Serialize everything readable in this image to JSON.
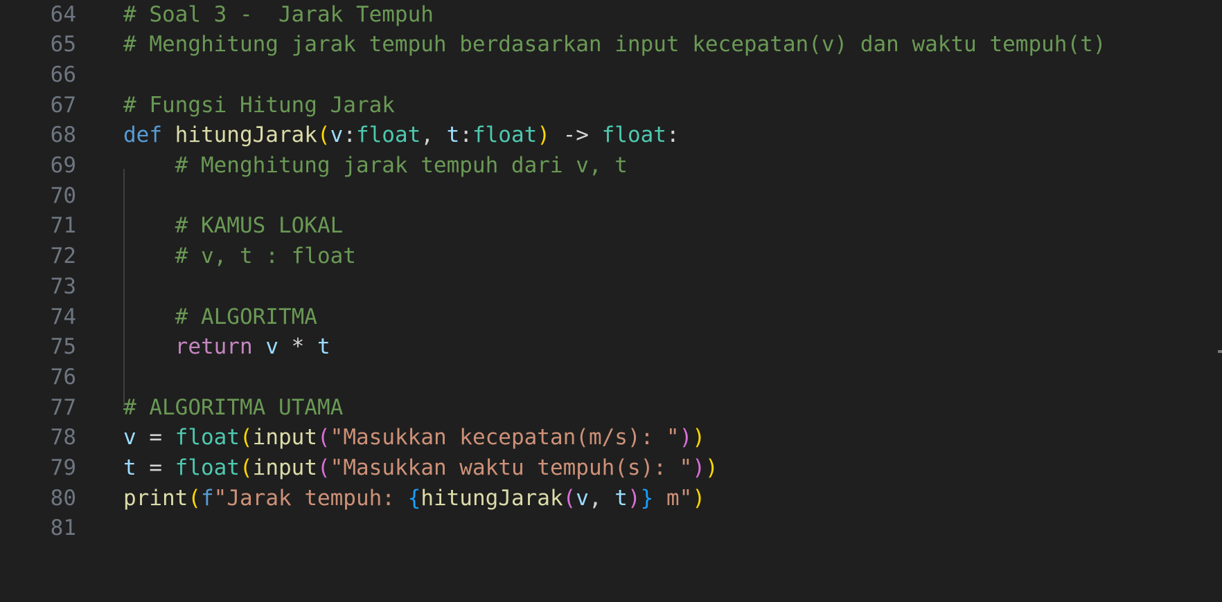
{
  "editor": {
    "lines": [
      {
        "n": "64",
        "tokens": [
          {
            "t": "# Soal 3 -  Jarak Tempuh",
            "c": "c"
          }
        ]
      },
      {
        "n": "65",
        "tokens": [
          {
            "t": "# Menghitung jarak tempuh berdasarkan input kecepatan(v) dan waktu tempuh(t)",
            "c": "c"
          }
        ]
      },
      {
        "n": "66",
        "tokens": []
      },
      {
        "n": "67",
        "tokens": [
          {
            "t": "# Fungsi Hitung Jarak",
            "c": "c"
          }
        ]
      },
      {
        "n": "68",
        "tokens": [
          {
            "t": "def ",
            "c": "k"
          },
          {
            "t": "hitungJarak",
            "c": "fn"
          },
          {
            "t": "(",
            "c": "b1"
          },
          {
            "t": "v",
            "c": "v"
          },
          {
            "t": ":",
            "c": "p"
          },
          {
            "t": "float",
            "c": "ty"
          },
          {
            "t": ", ",
            "c": "p"
          },
          {
            "t": "t",
            "c": "v"
          },
          {
            "t": ":",
            "c": "p"
          },
          {
            "t": "float",
            "c": "ty"
          },
          {
            "t": ")",
            "c": "b1"
          },
          {
            "t": " -> ",
            "c": "p"
          },
          {
            "t": "float",
            "c": "ty"
          },
          {
            "t": ":",
            "c": "p"
          }
        ]
      },
      {
        "n": "69",
        "tokens": [
          {
            "t": "    # Menghitung jarak tempuh dari v, t",
            "c": "c"
          }
        ]
      },
      {
        "n": "70",
        "tokens": []
      },
      {
        "n": "71",
        "tokens": [
          {
            "t": "    # KAMUS LOKAL",
            "c": "c"
          }
        ]
      },
      {
        "n": "72",
        "tokens": [
          {
            "t": "    # v, t : float",
            "c": "c"
          }
        ]
      },
      {
        "n": "73",
        "tokens": []
      },
      {
        "n": "74",
        "tokens": [
          {
            "t": "    # ALGORITMA",
            "c": "c"
          }
        ]
      },
      {
        "n": "75",
        "tokens": [
          {
            "t": "    ",
            "c": "p"
          },
          {
            "t": "return",
            "c": "kw"
          },
          {
            "t": " ",
            "c": "p"
          },
          {
            "t": "v",
            "c": "v"
          },
          {
            "t": " * ",
            "c": "p"
          },
          {
            "t": "t",
            "c": "v"
          }
        ]
      },
      {
        "n": "76",
        "tokens": []
      },
      {
        "n": "77",
        "tokens": [
          {
            "t": "# ALGORITMA UTAMA",
            "c": "c"
          }
        ]
      },
      {
        "n": "78",
        "tokens": [
          {
            "t": "v",
            "c": "v"
          },
          {
            "t": " = ",
            "c": "p"
          },
          {
            "t": "float",
            "c": "ty"
          },
          {
            "t": "(",
            "c": "b1"
          },
          {
            "t": "input",
            "c": "fn"
          },
          {
            "t": "(",
            "c": "b2"
          },
          {
            "t": "\"Masukkan kecepatan(m/s): \"",
            "c": "s"
          },
          {
            "t": ")",
            "c": "b2"
          },
          {
            "t": ")",
            "c": "b1"
          }
        ]
      },
      {
        "n": "79",
        "tokens": [
          {
            "t": "t",
            "c": "v"
          },
          {
            "t": " = ",
            "c": "p"
          },
          {
            "t": "float",
            "c": "ty"
          },
          {
            "t": "(",
            "c": "b1"
          },
          {
            "t": "input",
            "c": "fn"
          },
          {
            "t": "(",
            "c": "b2"
          },
          {
            "t": "\"Masukkan waktu tempuh(s): \"",
            "c": "s"
          },
          {
            "t": ")",
            "c": "b2"
          },
          {
            "t": ")",
            "c": "b1"
          }
        ]
      },
      {
        "n": "80",
        "tokens": [
          {
            "t": "print",
            "c": "fn"
          },
          {
            "t": "(",
            "c": "b1"
          },
          {
            "t": "f",
            "c": "k"
          },
          {
            "t": "\"Jarak tempuh: ",
            "c": "s"
          },
          {
            "t": "{",
            "c": "b3"
          },
          {
            "t": "hitungJarak",
            "c": "fn"
          },
          {
            "t": "(",
            "c": "b2"
          },
          {
            "t": "v",
            "c": "v"
          },
          {
            "t": ", ",
            "c": "p"
          },
          {
            "t": "t",
            "c": "v"
          },
          {
            "t": ")",
            "c": "b2"
          },
          {
            "t": "}",
            "c": "b3"
          },
          {
            "t": " m\"",
            "c": "s"
          },
          {
            "t": ")",
            "c": "b1"
          }
        ]
      },
      {
        "n": "81",
        "tokens": []
      }
    ]
  }
}
